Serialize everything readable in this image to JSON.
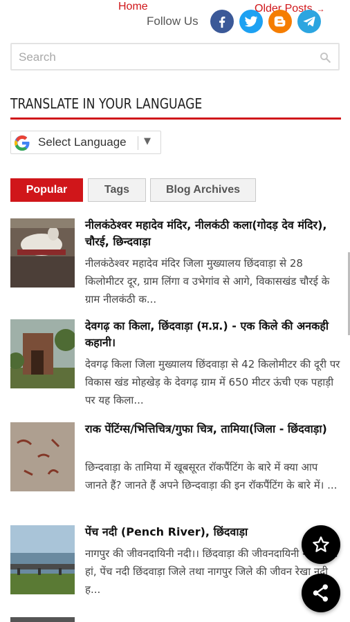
{
  "nav": {
    "home_label": "Home",
    "older_label": "Older Posts",
    "older_arrow": "→"
  },
  "follow": {
    "label": "Follow Us",
    "icons": [
      "facebook-icon",
      "twitter-icon",
      "blogger-icon",
      "telegram-icon"
    ],
    "colors": {
      "facebook": "#3b5998",
      "twitter": "#1da1f2",
      "blogger": "#f57d00",
      "telegram": "#2ca5e0"
    }
  },
  "search": {
    "placeholder": "Search"
  },
  "translate": {
    "title": "TRANSLATE IN YOUR LANGUAGE",
    "select_label": "Select Language",
    "arrow": "▼"
  },
  "tabs": [
    {
      "label": "Popular"
    },
    {
      "label": "Tags"
    },
    {
      "label": "Blog Archives"
    }
  ],
  "posts": [
    {
      "title": "नीलकंठेश्वर महादेव मंदिर, नीलकंठी कला(गोदड़ देव मंदिर), चौरई, छिन्दवाड़ा",
      "snippet": "नीलकंठेश्वर महादेव मंदिर जिला मुख्यालय छिंदवाड़ा से 28 किलोमीटर दूर, ग्राम लिंगा व उभेगांव  से आगे, विकासखंड चौरई के ग्राम नीलकंठी क..."
    },
    {
      "title": "देवगढ़ का किला, छिंदवाड़ा (म.प्र.) - एक किले की अनकही कहानी।",
      "snippet": "देवगढ़ किला  जिला मुख्यालय छिंदवाड़ा से 42 किलोमीटर की दूरी पर विकास खंड मोहखेड़  के देवगढ़ ग्राम में 650 मीटर ऊंची एक पहाड़ी पर यह किला..."
    },
    {
      "title": "राक पेंटिंग्स/भित्तिचित्र/गुफा चित्र, तामिया(जिला - छिंदवाड़ा)",
      "snippet": "छिन्दवाड़ा के तामिया में खूबसूरत रॉकपैंटिंग के बारे में क्या आप जानते हैं? जानते हैं अपने छिन्दवाड़ा की इन रॉकपैंटिंग  के बारे में। ..."
    },
    {
      "title": "पेंच नदी (Pench River), छिंदवाड़ा",
      "snippet": "नागपुर की जीवनदायिनी नदी।। छिंदवाड़ा की जीवनदायिनी नदी।। जी हां, पेंच नदी छिंदवाड़ा जिले तथा नागपुर जिले की जीवन रेखा नदी ह..."
    }
  ],
  "fabs": {
    "favorite_icon": "star-icon",
    "share_icon": "share-icon"
  },
  "accent_color": "#d0161a"
}
